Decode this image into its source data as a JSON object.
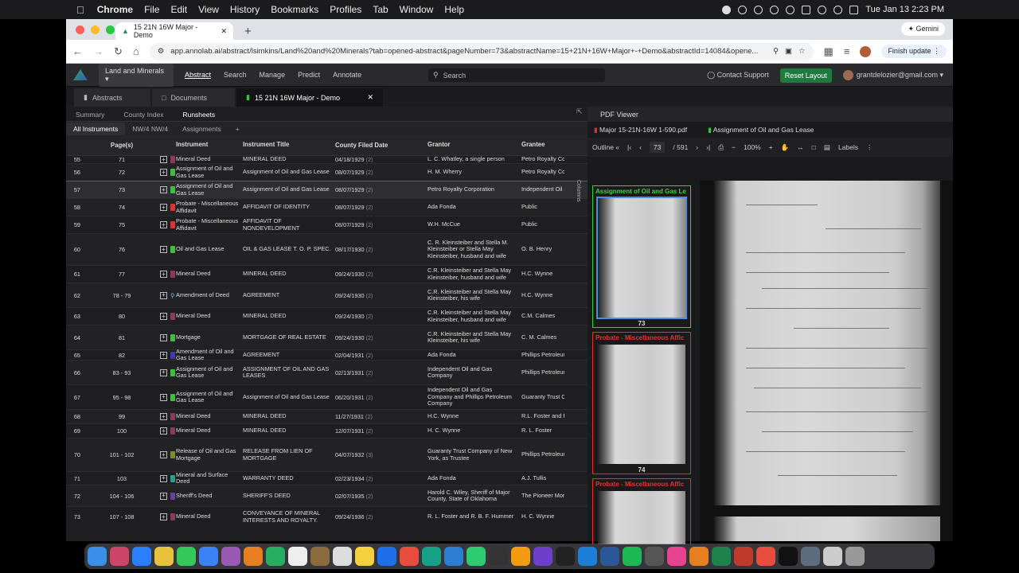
{
  "mac": {
    "app": "Chrome",
    "menus": [
      "File",
      "Edit",
      "View",
      "History",
      "Bookmarks",
      "Profiles",
      "Tab",
      "Window",
      "Help"
    ],
    "clock": "Tue Jan 13  2:23 PM"
  },
  "browser": {
    "tab_title": "15 21N 16W Major - Demo",
    "gemini": "Gemini",
    "url": "app.annolab.ai/abstract/lsimkins/Land%20and%20Minerals?tab=opened-abstract&pageNumber=73&abstractName=15+21N+16W+Major+-+Demo&abstractId=14084&opene...",
    "finish_update": "Finish update"
  },
  "app": {
    "project": "Land and Minerals",
    "nav": [
      "Abstract",
      "Search",
      "Manage",
      "Predict",
      "Annotate"
    ],
    "search_placeholder": "Search",
    "contact": "Contact Support",
    "reset": "Reset Layout",
    "user": "grantdelozier@gmail.com"
  },
  "doc_tabs": [
    "Abstracts",
    "Documents",
    "15 21N 16W Major - Demo"
  ],
  "subtabs": [
    "Summary",
    "County Index",
    "Runsheets"
  ],
  "subtabs2": [
    "All Instruments",
    "NW/4 NW/4",
    "Assignments",
    "+"
  ],
  "columns_label": "Columns",
  "table": {
    "headers": [
      "Page(s)",
      "Instrument",
      "Instrument Title",
      "County Filed Date",
      "Grantor",
      "Grantee"
    ],
    "rows": [
      {
        "n": "55",
        "pg": "71",
        "inst": "Mineral Deed",
        "title": "MINERAL DEED",
        "date": "04/18/1929",
        "cnt": "(2)",
        "grantor": "L. C. Whatley, a single person",
        "grantee": "Petro Royalty Co",
        "color": "#8a3b5c",
        "h": 10
      },
      {
        "n": "56",
        "pg": "72",
        "inst": "Assignment of Oil and Gas Lease",
        "title": "Assignment of Oil and Gas Lease",
        "date": "08/07/1929",
        "cnt": "(2)",
        "grantor": "H. M. Wherry",
        "grantee": "Petro Royalty Co",
        "color": "#3fbf3f",
        "h": 22
      },
      {
        "n": "57",
        "pg": "73",
        "inst": "Assignment of Oil and Gas Lease",
        "title": "Assignment of Oil and Gas Lease",
        "date": "08/07/1929",
        "cnt": "(2)",
        "grantor": "Petro Royalty Corporation",
        "grantee": "Independent Oil and Gas Company",
        "color": "#3fbf3f",
        "h": 22,
        "sel": true
      },
      {
        "n": "58",
        "pg": "74",
        "inst": "Probate - Miscellaneous Affidavit",
        "title": "AFFIDAVIT OF IDENTITY",
        "date": "08/07/1929",
        "cnt": "(2)",
        "grantor": "Ada Fonda",
        "grantee": "Public",
        "color": "#d33",
        "h": 22
      },
      {
        "n": "59",
        "pg": "75",
        "inst": "Probate - Miscellaneous Affidavit",
        "title": "AFFIDAVIT OF NONDEVELOPMENT",
        "date": "08/07/1929",
        "cnt": "(2)",
        "grantor": "W.H. McCue",
        "grantee": "Public",
        "color": "#d33",
        "h": 22
      },
      {
        "n": "60",
        "pg": "76",
        "inst": "Oil and Gas Lease",
        "title": "OIL & GAS LEASE T. O. P. SPEC.",
        "date": "08/17/1930",
        "cnt": "(2)",
        "grantor": "C. R. Kleinsteiber and Stella M. Kleinsteiber or Stella May Kleinsteiber, husband and wife",
        "grantee": "O. B. Henry",
        "color": "#3fbf3f",
        "h": 40
      },
      {
        "n": "61",
        "pg": "77",
        "inst": "Mineral Deed",
        "title": "MINERAL DEED",
        "date": "09/24/1930",
        "cnt": "(2)",
        "grantor": "C.R. Kleinsteiber and Stella May Kleinsteiber, husband and wife",
        "grantee": "H.C. Wynne",
        "color": "#8a3b5c",
        "h": 22
      },
      {
        "n": "62",
        "pg": "78 - 79",
        "inst": "Amendment of Deed",
        "title": "AGREEMENT",
        "date": "09/24/1930",
        "cnt": "(2)",
        "grantor": "C.R. Kleinsteiber and Stella May Kleinsteiber, his wife",
        "grantee": "H.C. Wynne",
        "color": "search",
        "h": 31
      },
      {
        "n": "63",
        "pg": "80",
        "inst": "Mineral Deed",
        "title": "MINERAL DEED",
        "date": "09/24/1930",
        "cnt": "(2)",
        "grantor": "C.R. Kleinsteiber and Stella May Kleinsteiber, husband and wife",
        "grantee": "C.M. Calmes",
        "color": "#8a3b5c",
        "h": 22
      },
      {
        "n": "64",
        "pg": "81",
        "inst": "Mortgage",
        "title": "MORTGAGE OF REAL ESTATE",
        "date": "09/24/1930",
        "cnt": "(2)",
        "grantor": "C.R. Kleinsteiber and Stella May Kleinsteiber, his wife",
        "grantee": "C. M. Calmes",
        "color": "#3fbf3f",
        "h": 31
      },
      {
        "n": "65",
        "pg": "82",
        "inst": "Amendment of Oil and Gas Lease",
        "title": "AGREEMENT",
        "date": "02/04/1931",
        "cnt": "(2)",
        "grantor": "Ada Fonda",
        "grantee": "Phillips Petroleum",
        "color": "#3b3bb0",
        "h": 13
      },
      {
        "n": "66",
        "pg": "83 - 93",
        "inst": "Assignment of Oil and Gas Lease",
        "title": "ASSIGNMENT OF OIL AND GAS LEASES",
        "date": "02/13/1931",
        "cnt": "(2)",
        "grantor": "Independent Oil and Gas Company",
        "grantee": "Phillips Petroleum",
        "color": "#3fbf3f",
        "h": 31
      },
      {
        "n": "67",
        "pg": "95 - 98",
        "inst": "Assignment of Oil and Gas Lease",
        "title": "Assignment of Oil and Gas Lease",
        "date": "06/20/1931",
        "cnt": "(2)",
        "grantor": "Independent Oil and Gas Company and Phillips Petroleum Company",
        "grantee": "Guaranty Trust Co York",
        "color": "#3fbf3f",
        "h": 31
      },
      {
        "n": "68",
        "pg": "99",
        "inst": "Mineral Deed",
        "title": "MINERAL DEED",
        "date": "11/27/1931",
        "cnt": "(2)",
        "grantor": "H.C. Wynne",
        "grantee": "R.L. Foster and R",
        "color": "#8a3b5c",
        "h": 18
      },
      {
        "n": "69",
        "pg": "100",
        "inst": "Mineral Deed",
        "title": "MINERAL DEED",
        "date": "12/07/1931",
        "cnt": "(2)",
        "grantor": "H. C. Wynne",
        "grantee": "R. L. Foster",
        "color": "#8a3b5c",
        "h": 18
      },
      {
        "n": "70",
        "pg": "101 - 102",
        "inst": "Release of Oil and Gas Mortgage",
        "title": "RELEASE FROM LIEN OF MORTGAGE",
        "date": "04/07/1932",
        "cnt": "(3)",
        "grantor": "Guaranty Trust Company of New York, as Trustee",
        "grantee": "Phillips Petroleum Independent Oil Company",
        "color": "#7a8f2a",
        "h": 42
      },
      {
        "n": "71",
        "pg": "103",
        "inst": "Mineral and Surface Deed",
        "title": "WARRANTY DEED",
        "date": "02/23/1934",
        "cnt": "(2)",
        "grantor": "Ada Fonda",
        "grantee": "A.J. Tullis",
        "color": "#2a9f8f",
        "h": 17
      },
      {
        "n": "72",
        "pg": "104 - 106",
        "inst": "Sheriff's Deed",
        "title": "SHERIFF'S DEED",
        "date": "02/07/1935",
        "cnt": "(2)",
        "grantor": "Harold C. Wiley, Sheriff of Major County, State of Oklahoma",
        "grantee": "The Pioneer Mort a corporation",
        "color": "#6b3fa0",
        "h": 27
      },
      {
        "n": "73",
        "pg": "107 - 108",
        "inst": "Mineral Deed",
        "title": "CONVEYANCE OF MINERAL INTERESTS AND ROYALTY.",
        "date": "09/24/1936",
        "cnt": "(2)",
        "grantor": "R. L. Foster and R. B. F. Hummer",
        "grantee": "H. C. Wynne",
        "color": "#8a3b5c",
        "h": 26
      }
    ]
  },
  "pdf": {
    "title": "PDF Viewer",
    "file": "Major 15-21N-16W 1-590.pdf",
    "doc_label": "Assignment of Oil and Gas Lease",
    "outline": "Outline",
    "page": "73",
    "pages": "/ 591",
    "zoom": "100%",
    "labels": "Labels",
    "thumbs": [
      {
        "label": "Assignment of Oil and Gas Le",
        "num": "73",
        "color": "#3fcf3f"
      },
      {
        "label": "Probate - Miscellaneous Affic",
        "num": "74",
        "color": "#d33"
      },
      {
        "label": "Probate - Miscellaneous Affic",
        "num": "",
        "color": "#d33"
      }
    ]
  }
}
